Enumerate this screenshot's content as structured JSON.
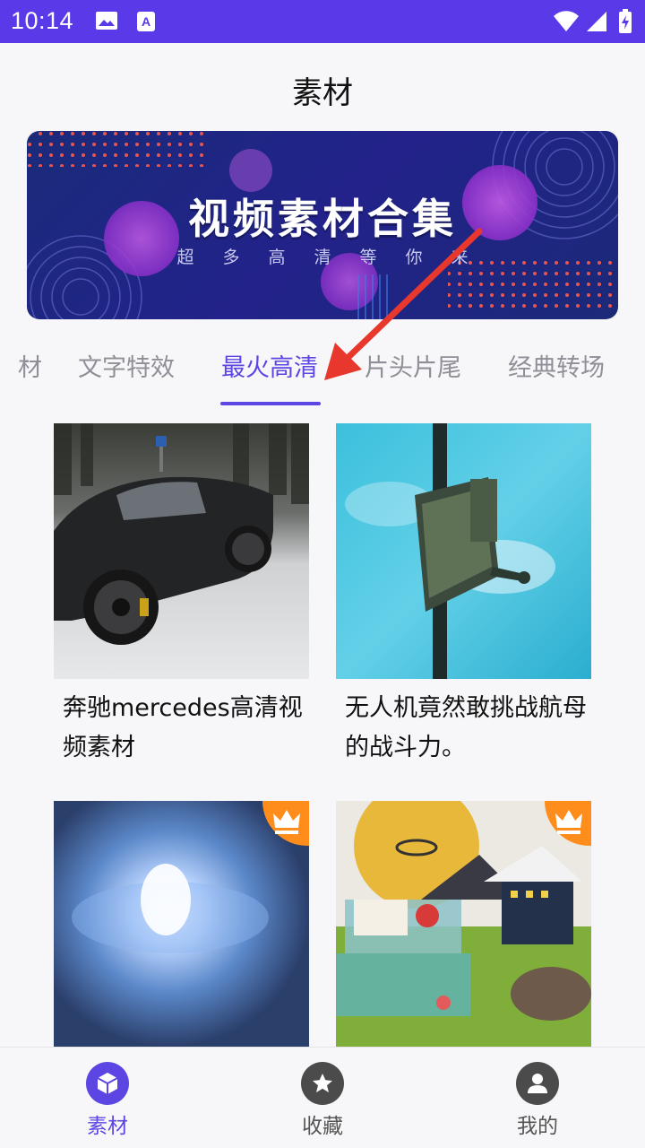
{
  "status_bar": {
    "time": "10:14"
  },
  "header": {
    "title": "素材"
  },
  "banner": {
    "title": "视频素材合集",
    "subtitle": "超多高清等你来"
  },
  "tabs": [
    {
      "label": "材"
    },
    {
      "label": "文字特效"
    },
    {
      "label": "最火高清"
    },
    {
      "label": "片头片尾"
    },
    {
      "label": "经典转场"
    }
  ],
  "active_tab": "最火高清",
  "cards": [
    {
      "title": "奔驰mercedes高清视频素材",
      "premium": false
    },
    {
      "title": "无人机竟然敢挑战航母的战斗力。",
      "premium": false
    },
    {
      "title": "",
      "premium": true
    },
    {
      "title": "",
      "premium": true
    }
  ],
  "bottom_nav": [
    {
      "label": "素材",
      "icon": "cube-icon",
      "active": true
    },
    {
      "label": "收藏",
      "icon": "star-icon",
      "active": false
    },
    {
      "label": "我的",
      "icon": "person-icon",
      "active": false
    }
  ],
  "colors": {
    "accent": "#5b45e3",
    "status_bar": "#5a3ae8",
    "crown_badge": "#ff8d1c"
  }
}
